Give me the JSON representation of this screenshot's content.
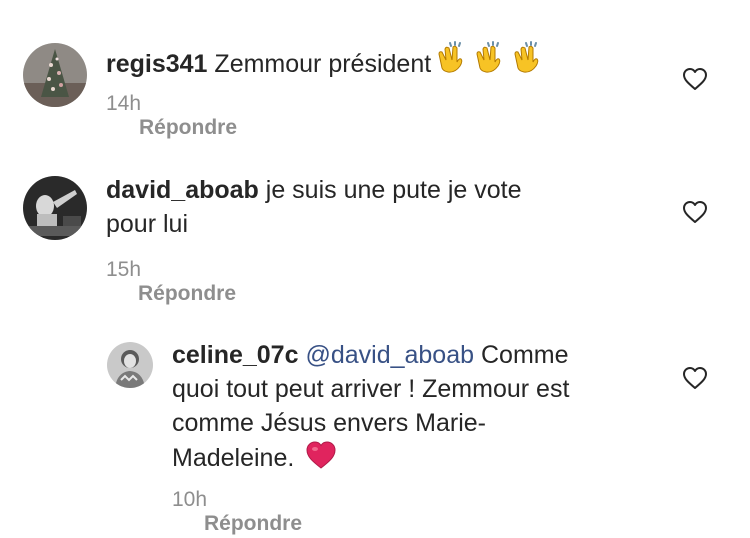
{
  "comments": [
    {
      "username": "regis341",
      "text": "Zemmour président",
      "emoji": [
        "clapping-hands",
        "clapping-hands",
        "clapping-hands"
      ],
      "time": "14h",
      "reply_label": "Répondre"
    },
    {
      "username": "david_aboab",
      "text_line1": "je suis une pute je vote",
      "text_line2": "pour lui",
      "time": "15h",
      "reply_label": "Répondre"
    },
    {
      "username": "celine_07c",
      "mention": "@david_aboab",
      "text_line1": "Comme",
      "text_line2": "quoi tout peut arriver ! Zemmour est",
      "text_line3": "comme Jésus envers Marie-",
      "text_line4": "Madeleine.",
      "emoji": [
        "red-heart"
      ],
      "time": "10h",
      "reply_label": "Répondre"
    }
  ],
  "icons": {
    "like": "heart-outline-icon",
    "clap": "clapping-hands-emoji",
    "heart": "red-heart-emoji"
  },
  "colors": {
    "text": "#262626",
    "secondary": "#8e8e8e",
    "mention": "#385185",
    "heart": "#e0245e",
    "clap": "#f7c325"
  }
}
